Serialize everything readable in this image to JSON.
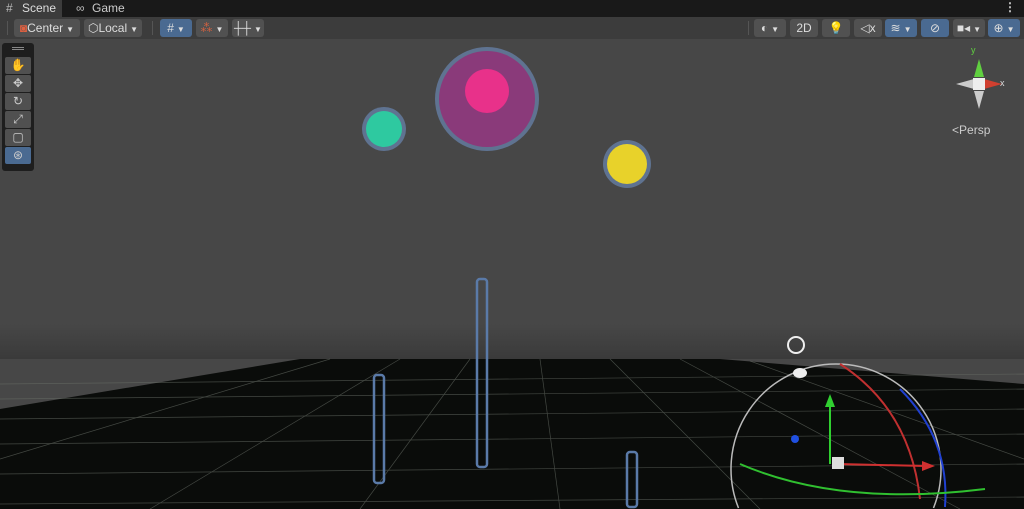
{
  "tabs": [
    {
      "label": "Scene",
      "icon": "grid-hash-icon"
    },
    {
      "label": "Game",
      "icon": "gamepad-icon"
    }
  ],
  "toolbar": {
    "pivot": "Center",
    "space": "Local",
    "mode_2d": "2D"
  },
  "tools": [
    "hand-tool",
    "move-tool",
    "rotate-tool",
    "scale-tool",
    "rect-tool",
    "transform-tool"
  ],
  "gizmo": {
    "y": "y",
    "x": "x",
    "projection": "Persp"
  },
  "colors": {
    "accent": "#4a6a91",
    "firework_pink": "#e8318a",
    "firework_teal": "#2ec9a0",
    "firework_yellow": "#e8d22a"
  }
}
